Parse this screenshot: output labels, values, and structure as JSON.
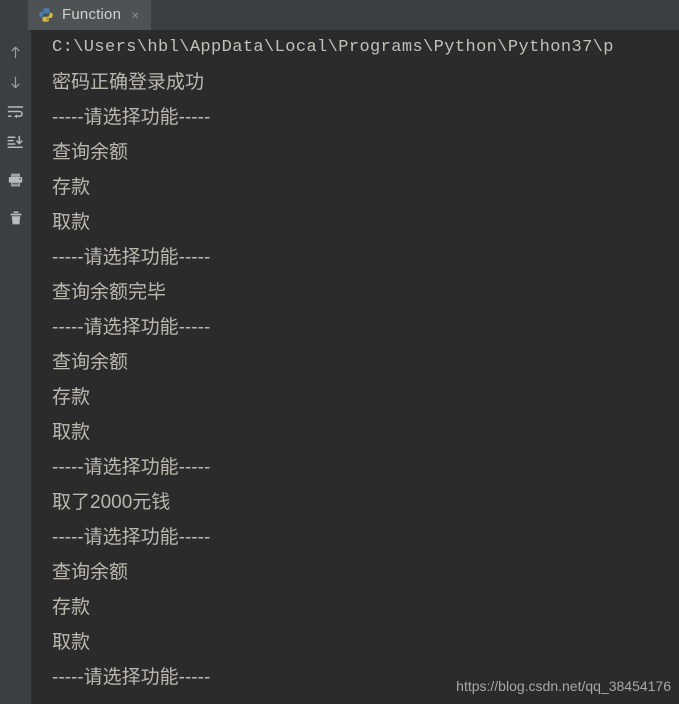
{
  "window": {
    "background_color": "#2b2b2b",
    "chrome_color": "#3c3f41"
  },
  "tab": {
    "label": "Function",
    "close_label": "×",
    "icon": "python-logo-icon",
    "active_color": "#4e5254"
  },
  "toolbar": {
    "items": [
      {
        "name": "up-arrow-icon",
        "tooltip": "Previous Occurrence"
      },
      {
        "name": "down-arrow-icon",
        "tooltip": "Next Occurrence"
      },
      {
        "name": "soft-wrap-icon",
        "tooltip": "Soft-Wrap"
      },
      {
        "name": "scroll-to-end-icon",
        "tooltip": "Scroll to the end"
      },
      {
        "name": "print-icon",
        "tooltip": "Print"
      },
      {
        "name": "trash-icon",
        "tooltip": "Clear All"
      }
    ]
  },
  "console": {
    "text_color": "#bbb7af",
    "lines": [
      {
        "text": "C:\\Users\\hbl\\AppData\\Local\\Programs\\Python\\Python37\\p",
        "mono": true
      },
      {
        "text": "密码正确登录成功",
        "mono": false
      },
      {
        "text": "-----请选择功能-----",
        "mono": false
      },
      {
        "text": "查询余额",
        "mono": false
      },
      {
        "text": "存款",
        "mono": false
      },
      {
        "text": "取款",
        "mono": false
      },
      {
        "text": "-----请选择功能-----",
        "mono": false
      },
      {
        "text": "查询余额完毕",
        "mono": false
      },
      {
        "text": "-----请选择功能-----",
        "mono": false
      },
      {
        "text": "查询余额",
        "mono": false
      },
      {
        "text": "存款",
        "mono": false
      },
      {
        "text": "取款",
        "mono": false
      },
      {
        "text": "-----请选择功能-----",
        "mono": false
      },
      {
        "text": "取了2000元钱",
        "mono": false
      },
      {
        "text": "-----请选择功能-----",
        "mono": false
      },
      {
        "text": "查询余额",
        "mono": false
      },
      {
        "text": "存款",
        "mono": false
      },
      {
        "text": "取款",
        "mono": false
      },
      {
        "text": "-----请选择功能-----",
        "mono": false
      }
    ]
  },
  "watermark": {
    "text": "https://blog.csdn.net/qq_38454176"
  }
}
